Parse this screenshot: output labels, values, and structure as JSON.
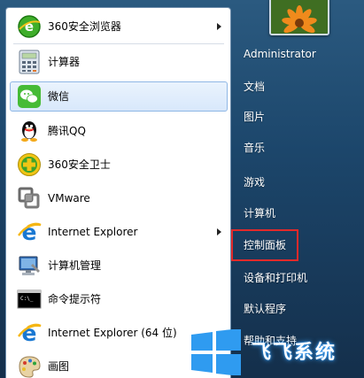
{
  "programs": [
    {
      "label": "360安全浏览器",
      "icon": "360-browser-icon",
      "has_submenu": true
    },
    {
      "label": "计算器",
      "icon": "calculator-icon",
      "has_submenu": false
    },
    {
      "label": "微信",
      "icon": "wechat-icon",
      "has_submenu": false,
      "highlighted": true
    },
    {
      "label": "腾讯QQ",
      "icon": "qq-penguin-icon",
      "has_submenu": false
    },
    {
      "label": "360安全卫士",
      "icon": "360-safe-guard-icon",
      "has_submenu": false
    },
    {
      "label": "VMware",
      "icon": "vmware-icon",
      "has_submenu": false
    },
    {
      "label": "Internet Explorer",
      "icon": "internet-explorer-icon",
      "has_submenu": true
    },
    {
      "label": "计算机管理",
      "icon": "computer-management-icon",
      "has_submenu": false
    },
    {
      "label": "命令提示符",
      "icon": "command-prompt-icon",
      "has_submenu": false
    },
    {
      "label": "Internet Explorer (64 位)",
      "icon": "internet-explorer-icon",
      "has_submenu": false
    },
    {
      "label": "画图",
      "icon": "paint-icon",
      "has_submenu": true
    }
  ],
  "right_pane": {
    "user_name": "Administrator",
    "items": [
      {
        "label": "文档"
      },
      {
        "label": "图片"
      },
      {
        "label": "音乐"
      },
      {
        "label": "游戏"
      },
      {
        "label": "计算机"
      },
      {
        "label": "控制面板",
        "highlighted": true
      },
      {
        "label": "设备和打印机"
      },
      {
        "label": "默认程序"
      },
      {
        "label": "帮助和支持"
      }
    ]
  },
  "watermark": {
    "text": "飞飞系统",
    "logo": "windows-logo-icon"
  },
  "colors": {
    "highlight_box": "#e22a2a",
    "hover_bg": "#dceafb",
    "pane_bg": "#1c466b"
  }
}
